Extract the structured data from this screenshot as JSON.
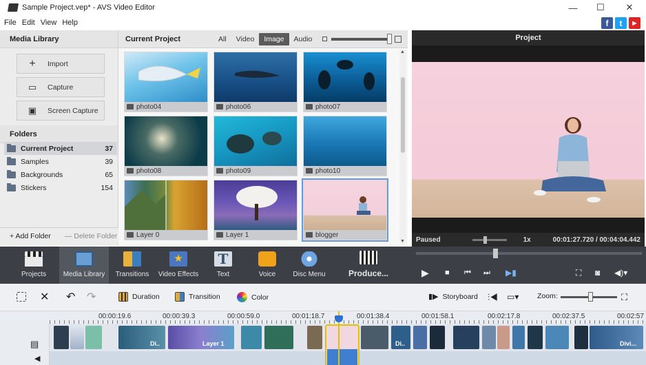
{
  "window": {
    "title": "Sample Project.vep* - AVS Video Editor",
    "minimize": "—",
    "maximize": "☐",
    "close": "✕"
  },
  "menu": [
    "File",
    "Edit",
    "View",
    "Help"
  ],
  "social": {
    "facebook": "f",
    "twitter": "t",
    "youtube": "▶"
  },
  "media_library": {
    "title": "Media Library",
    "buttons": [
      {
        "label": "Import",
        "icon": "plus-icon"
      },
      {
        "label": "Capture",
        "icon": "camera-icon"
      },
      {
        "label": "Screen Capture",
        "icon": "screen-capture-icon"
      }
    ],
    "folders_title": "Folders",
    "folders": [
      {
        "name": "Current Project",
        "count": "37"
      },
      {
        "name": "Samples",
        "count": "39"
      },
      {
        "name": "Backgrounds",
        "count": "65"
      },
      {
        "name": "Stickers",
        "count": "154"
      }
    ],
    "add_folder": "+ Add Folder",
    "delete_folder": "— Delete Folder"
  },
  "current_project": {
    "title": "Current Project",
    "filters": [
      "All",
      "Video",
      "Image",
      "Audio"
    ],
    "active_filter": "Image",
    "thumbs": [
      "photo04",
      "photo06",
      "photo07",
      "photo08",
      "photo09",
      "photo10",
      "Layer 0",
      "Layer 1",
      "blogger"
    ]
  },
  "preview": {
    "title": "Project",
    "status": "Paused",
    "speed": "1x",
    "time": "00:01:27.720 / 00:04:04.442"
  },
  "toolbar": [
    {
      "label": "Projects",
      "icon": "projects-icon"
    },
    {
      "label": "Media Library",
      "icon": "media-library-icon"
    },
    {
      "label": "Transitions",
      "icon": "transitions-icon"
    },
    {
      "label": "Video Effects",
      "icon": "video-effects-icon"
    },
    {
      "label": "Text",
      "icon": "text-icon"
    },
    {
      "label": "Voice",
      "icon": "voice-icon"
    },
    {
      "label": "Disc Menu",
      "icon": "disc-menu-icon"
    },
    {
      "label": "Produce...",
      "icon": "produce-icon"
    }
  ],
  "timeline_tools": {
    "duration": "Duration",
    "transition": "Transition",
    "color": "Color",
    "storyboard": "Storyboard",
    "zoom": "Zoom:"
  },
  "ruler": [
    "00:00:19.6",
    "00:00:39.3",
    "00:00:59.0",
    "00:01:18.7",
    "00:01:38.4",
    "00:01:58.1",
    "00:02:17.8",
    "00:02:37.5",
    "00:02:57"
  ],
  "clips": {
    "layer1": "Layer 1",
    "div_short": "Di..",
    "div_long": "Divi..."
  }
}
